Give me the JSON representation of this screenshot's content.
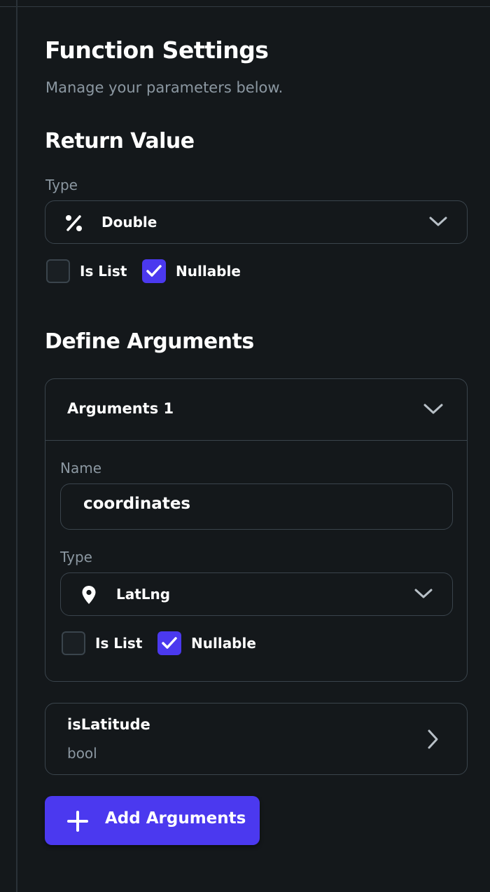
{
  "header": {
    "title": "Function Settings",
    "subtitle": "Manage your parameters below."
  },
  "return_value": {
    "section_title": "Return Value",
    "type_label": "Type",
    "type_value": "Double",
    "type_icon": "percent-icon",
    "is_list_label": "Is List",
    "is_list_checked": false,
    "nullable_label": "Nullable",
    "nullable_checked": true
  },
  "arguments": {
    "section_title": "Define Arguments",
    "expanded": {
      "title": "Arguments 1",
      "name_label": "Name",
      "name_value": "coordinates",
      "type_label": "Type",
      "type_value": "LatLng",
      "type_icon": "map-pin-icon",
      "is_list_label": "Is List",
      "is_list_checked": false,
      "nullable_label": "Nullable",
      "nullable_checked": true
    },
    "collapsed": [
      {
        "name": "isLatitude",
        "type": "bool"
      }
    ],
    "add_button_label": "Add Arguments"
  },
  "colors": {
    "background": "#14181b",
    "border": "#3a444c",
    "accent": "#4b39ef",
    "secondary_text": "#8b97a1",
    "primary_text": "#ffffff"
  }
}
